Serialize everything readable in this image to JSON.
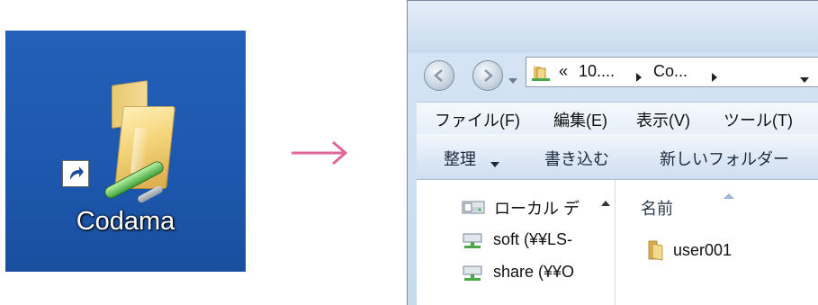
{
  "desktop": {
    "shortcut_label": "Codama",
    "icon": "network-folder-shortcut-icon"
  },
  "arrow": {
    "color": "#e2679c",
    "icon": "right-arrow-icon"
  },
  "explorer": {
    "address": {
      "prefix": "«",
      "parts": [
        "10....",
        "Co..."
      ],
      "separator_icon": "breadcrumb-chevron-icon"
    },
    "menu": [
      "ファイル(F)",
      "編集(E)",
      "表示(V)",
      "ツール(T)"
    ],
    "toolbar": {
      "organize": "整理",
      "burn": "書き込む",
      "new_folder": "新しいフォルダー"
    },
    "nav_pane": [
      {
        "label": "ローカル デ",
        "icon": "local-drive-icon"
      },
      {
        "label": "soft (¥¥LS-",
        "icon": "network-drive-icon"
      },
      {
        "label": "share (¥¥O",
        "icon": "network-drive-icon"
      }
    ],
    "content": {
      "column_header": "名前",
      "items": [
        {
          "name": "user001",
          "icon": "folder-icon"
        }
      ]
    }
  },
  "colors": {
    "desktop_bg": "#1d57ad",
    "arrow": "#e2679c",
    "window_frame": "#c9dcef"
  }
}
